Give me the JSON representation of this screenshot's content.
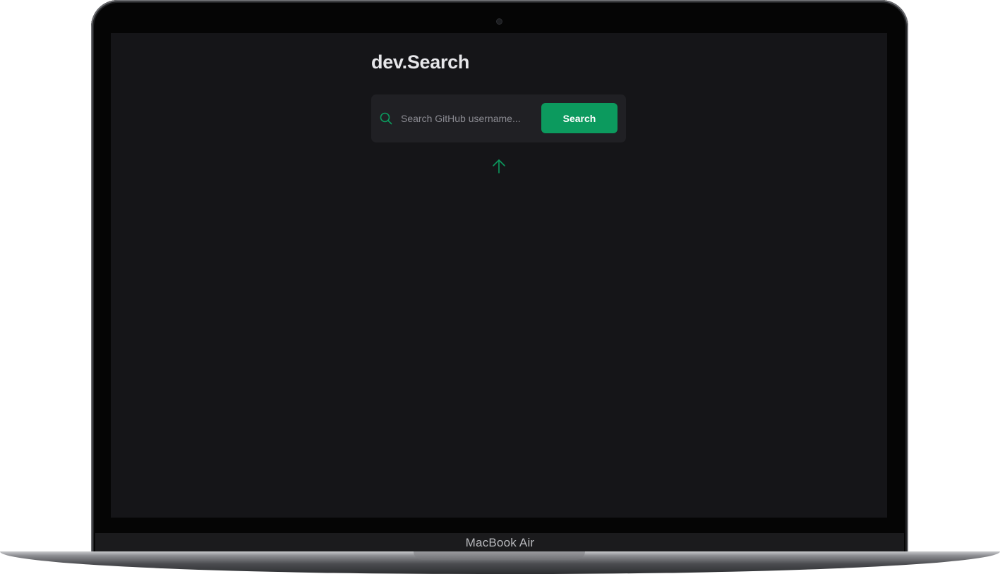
{
  "app": {
    "title": "dev.Search"
  },
  "search": {
    "placeholder": "Search GitHub username...",
    "value": "",
    "button_label": "Search"
  },
  "icons": {
    "search": "search-icon",
    "hint_arrow": "arrow-up-icon"
  },
  "device": {
    "label": "MacBook Air"
  },
  "colors": {
    "background": "#151518",
    "card": "#202024",
    "accent": "#0c9a5e",
    "title_text": "#e7e7ea",
    "placeholder_text": "#8b8b92"
  }
}
